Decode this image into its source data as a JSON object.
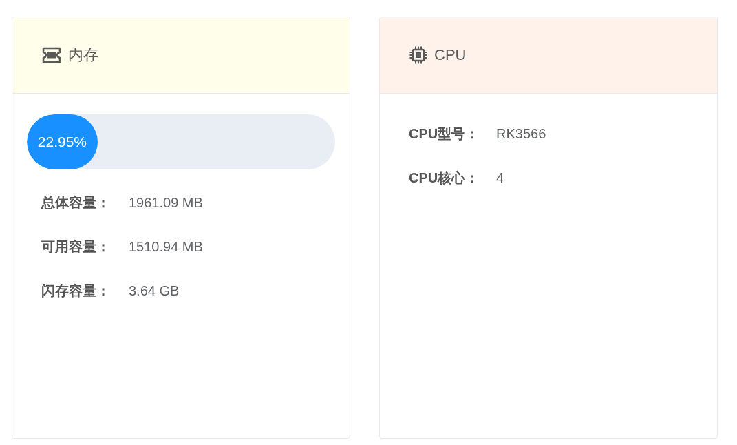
{
  "cards": [
    {
      "kind": "memory",
      "title": "内存",
      "usage": {
        "level": 0.2295,
        "reading": "22.95%"
      },
      "rows": [
        {
          "label": "总体容量：",
          "value": "1961.09 MB"
        },
        {
          "label": "可用容量：",
          "value": "1510.94 MB"
        },
        {
          "label": "闪存容量：",
          "value": "3.64 GB"
        }
      ]
    },
    {
      "kind": "cpu",
      "title": "CPU",
      "rows": [
        {
          "label": "CPU型号：",
          "value": "RK3566"
        },
        {
          "label": "CPU核心：",
          "value": "4"
        }
      ]
    }
  ]
}
